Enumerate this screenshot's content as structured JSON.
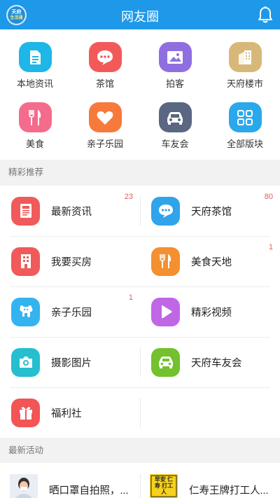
{
  "header": {
    "title": "网友圈",
    "logo_line1": "天府",
    "logo_line2": "生活通",
    "brand_color": "#1e98e8"
  },
  "quick_nav": {
    "items": [
      {
        "label": "本地资讯",
        "icon": "document-icon",
        "color": "#1fb6e8"
      },
      {
        "label": "茶馆",
        "icon": "chat-bubble-icon",
        "color": "#f25a5a"
      },
      {
        "label": "拍客",
        "icon": "image-icon",
        "color": "#8f6fe0"
      },
      {
        "label": "天府楼市",
        "icon": "building-icon",
        "color": "#d7b878"
      },
      {
        "label": "美食",
        "icon": "fork-knife-icon",
        "color": "#f56b8c"
      },
      {
        "label": "亲子乐园",
        "icon": "heart-icon",
        "color": "#f7793c"
      },
      {
        "label": "车友会",
        "icon": "car-icon",
        "color": "#5b6682"
      },
      {
        "label": "全部版块",
        "icon": "grid-icon",
        "color": "#2aa8ec"
      }
    ]
  },
  "featured": {
    "heading": "精彩推荐",
    "items": [
      {
        "label": "最新资讯",
        "count": "23",
        "icon": "news-icon",
        "color": "#f05a5a"
      },
      {
        "label": "天府茶馆",
        "count": "80",
        "icon": "chat-bubble-icon",
        "color": "#2fa4ea"
      },
      {
        "label": "我要买房",
        "count": "",
        "icon": "building-icon",
        "color": "#f05a5a"
      },
      {
        "label": "美食天地",
        "count": "1",
        "icon": "fork-knife-icon",
        "color": "#f4902f"
      },
      {
        "label": "亲子乐园",
        "count": "1",
        "icon": "elephant-icon",
        "color": "#34b4ef"
      },
      {
        "label": "精彩视频",
        "count": "",
        "icon": "play-icon",
        "color": "#c067e6"
      },
      {
        "label": "摄影图片",
        "count": "",
        "icon": "camera-icon",
        "color": "#25bfcf"
      },
      {
        "label": "天府车友会",
        "count": "",
        "icon": "car-icon",
        "color": "#73c12e"
      },
      {
        "label": "福利社",
        "count": "",
        "icon": "gift-icon",
        "color": "#f25555"
      }
    ]
  },
  "activities": {
    "heading": "最新活动",
    "items": [
      {
        "title": "晒口罩自拍照，...",
        "thumb": "mask-selfie-thumbnail"
      },
      {
        "title": "仁寿王牌打工人...",
        "thumb": "poster-thumbnail",
        "thumb_text": "早安 仁寿 打工人"
      }
    ]
  }
}
